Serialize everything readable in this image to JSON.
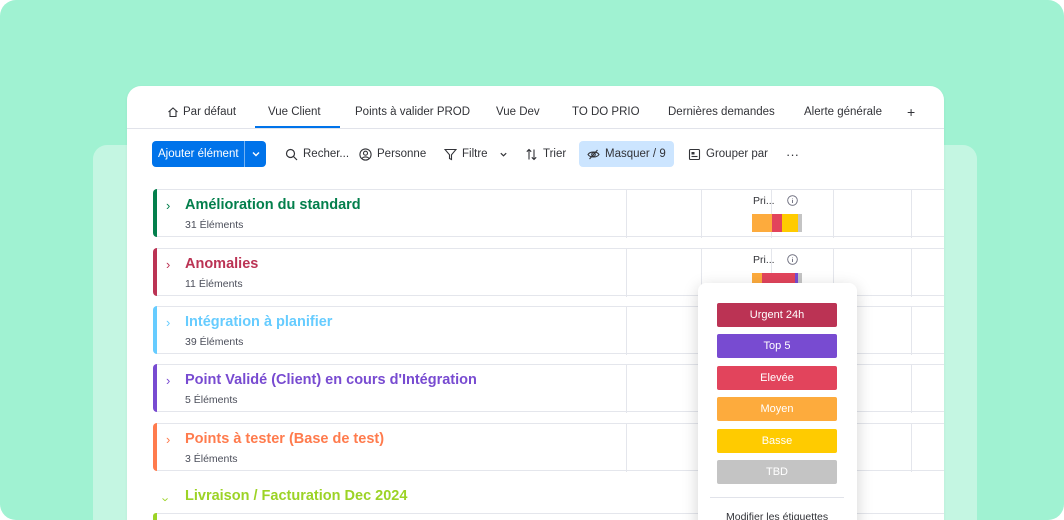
{
  "tabs": [
    {
      "label": "Par défaut",
      "icon": "home-icon"
    },
    {
      "label": "Vue Client"
    },
    {
      "label": "Points à valider PROD"
    },
    {
      "label": "Vue Dev"
    },
    {
      "label": "TO DO PRIO"
    },
    {
      "label": "Dernières demandes"
    },
    {
      "label": "Alerte générale"
    }
  ],
  "tab_add": "+",
  "toolbar": {
    "add_item": "Ajouter élément",
    "search": "Recher...",
    "person": "Personne",
    "filter": "Filtre",
    "sort": "Trier",
    "hide": "Masquer / 9",
    "group_by": "Grouper par",
    "more": "···"
  },
  "groups": [
    {
      "title": "Amélioration du standard",
      "count": "31 Éléments",
      "color": "#037f4c",
      "priority_header": "Pri...",
      "priority_bar": [
        {
          "color": "#fdab3d",
          "share": 0.4
        },
        {
          "color": "#e2445c",
          "share": 0.2
        },
        {
          "color": "#ffcb00",
          "share": 0.32
        },
        {
          "color": "#c4c4c4",
          "share": 0.08
        }
      ]
    },
    {
      "title": "Anomalies",
      "count": "11 Éléments",
      "color": "#bb3354",
      "priority_header": "Pri...",
      "priority_bar": [
        {
          "color": "#fdab3d",
          "share": 0.2
        },
        {
          "color": "#e2445c",
          "share": 0.66
        },
        {
          "color": "#784bd1",
          "share": 0.06
        },
        {
          "color": "#c4c4c4",
          "share": 0.08
        }
      ]
    },
    {
      "title": "Intégration à planifier",
      "count": "39 Éléments",
      "color": "#66ccff"
    },
    {
      "title": "Point Validé (Client) en cours d'Intégration",
      "count": "5 Éléments",
      "color": "#784bd1"
    },
    {
      "title": "Points à tester (Base de test)",
      "count": "3 Éléments",
      "color": "#ff7b4d"
    },
    {
      "title": "Livraison / Facturation Dec 2024",
      "count": "",
      "color": "#9cd326"
    }
  ],
  "dropdown": {
    "labels": [
      {
        "label": "Urgent 24h",
        "color": "#bb3354"
      },
      {
        "label": "Top 5",
        "color": "#784bd1"
      },
      {
        "label": "Elevée",
        "color": "#e2445c"
      },
      {
        "label": "Moyen",
        "color": "#fdab3d"
      },
      {
        "label": "Basse",
        "color": "#ffcb00"
      },
      {
        "label": "TBD",
        "color": "#c4c4c4"
      }
    ],
    "edit_labels": "Modifier les étiquettes"
  }
}
